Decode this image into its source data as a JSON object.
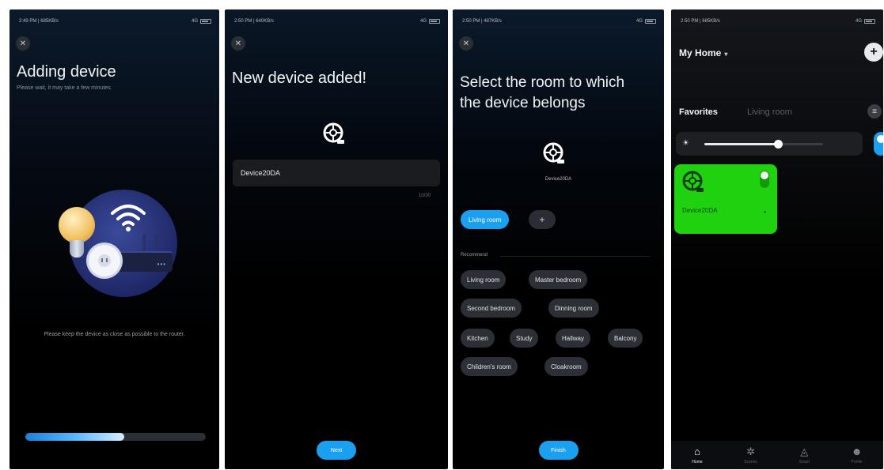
{
  "screen1": {
    "status_time": "2:49 PM | 685KB/s",
    "status_right": "4G",
    "title": "Adding device",
    "subtitle": "Please wait, it may take a few minutes.",
    "hint": "Please keep the device as close as possible to the router.",
    "progress": 0.55
  },
  "screen2": {
    "status_time": "2:50 PM | 640KB/s",
    "status_right": "4G",
    "title": "New device added!",
    "device_name_value": "Device20DA",
    "counter": "10/30",
    "next_label": "Next"
  },
  "screen3": {
    "status_time": "2:50 PM | 487KB/s",
    "status_right": "4G",
    "title_line1": "Select the room to which",
    "title_line2": "the device belongs",
    "device_name": "Device20DA",
    "selected_room": "Living room",
    "add_label": "+",
    "recommend_label": "Recommend",
    "recommended_rooms": [
      "Living room",
      "Master bedroom",
      "Second bedroom",
      "Dinning room",
      "Kitchen",
      "Study",
      "Hallway",
      "Balcony",
      "Children's room",
      "Cloakroom"
    ],
    "finish_label": "Finish"
  },
  "screen4": {
    "status_time": "2:50 PM | 685KB/s",
    "status_right": "4G",
    "home_title": "My Home",
    "add_label": "+",
    "tab_favorites": "Favorites",
    "tab_living": "Living room",
    "brightness": 0.62,
    "card_device_name": "Device20DA",
    "card_more": "•",
    "nav": [
      {
        "label": "Home",
        "icon": "home-icon"
      },
      {
        "label": "Scenes",
        "icon": "scenes-icon"
      },
      {
        "label": "Smart",
        "icon": "smart-icon"
      },
      {
        "label": "Profile",
        "icon": "profile-icon"
      }
    ]
  },
  "colors": {
    "accent": "#1aa0ee",
    "card_green": "#1fd10f",
    "background": "#000000"
  }
}
